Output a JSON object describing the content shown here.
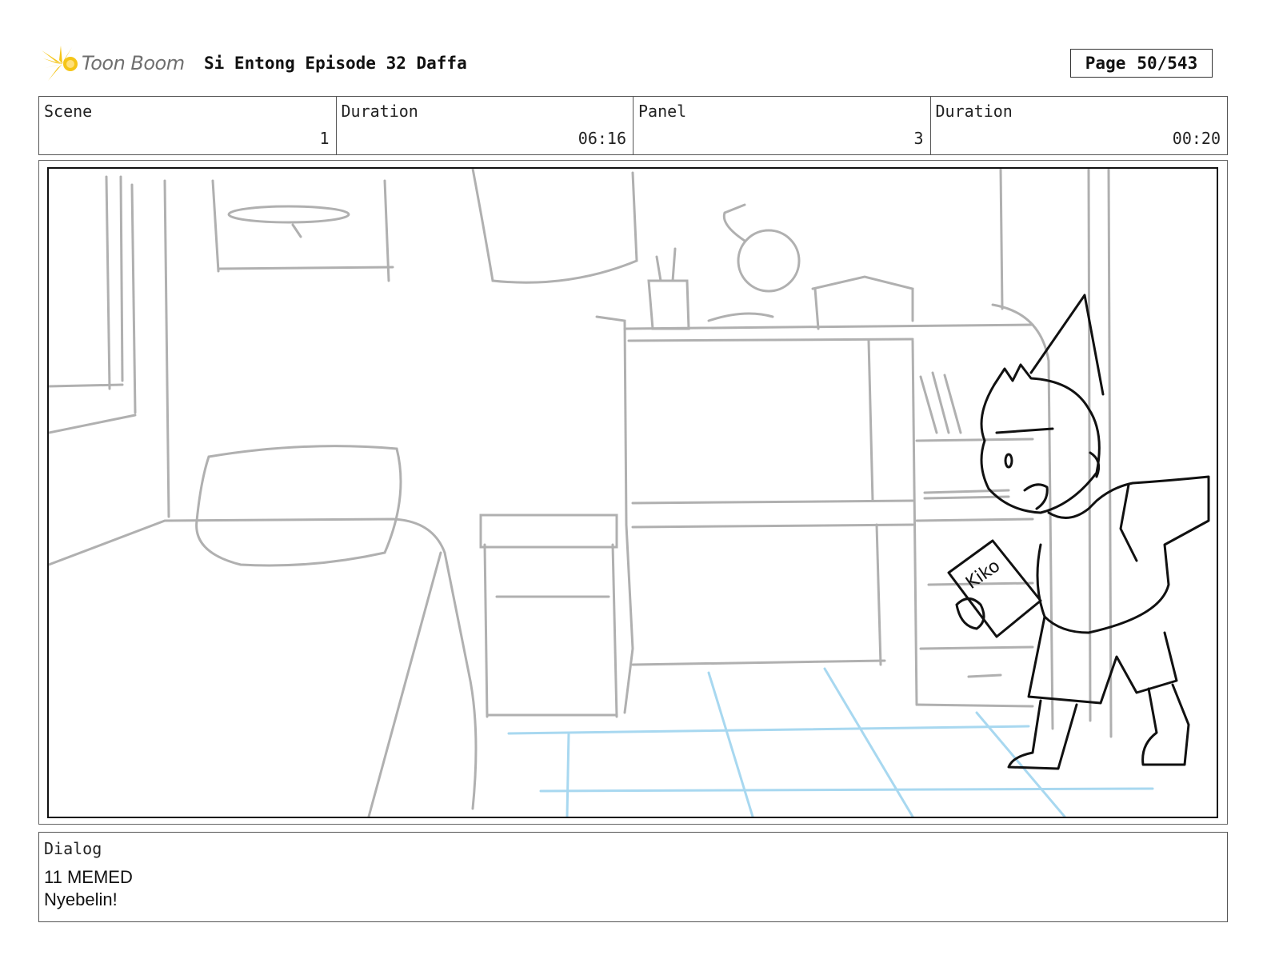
{
  "header": {
    "logo_text": "Toon Boom",
    "title": "Si Entong Episode 32 Daffa",
    "page_label": "Page",
    "page_value": "50/543"
  },
  "info": [
    {
      "label": "Scene",
      "value": "1"
    },
    {
      "label": "Duration",
      "value": "06:16"
    },
    {
      "label": "Panel",
      "value": "3"
    },
    {
      "label": "Duration",
      "value": "00:20"
    }
  ],
  "panel_sketch": {
    "book_text": "Kiko"
  },
  "dialog": {
    "label": "Dialog",
    "lines": [
      "11 MEMED",
      "Nyebelin!"
    ]
  },
  "colors": {
    "logo_accent": "#f5c518",
    "sketch_gray": "#b0b0b0",
    "floor_blue": "#a8d8f0",
    "character_ink": "#111111"
  }
}
